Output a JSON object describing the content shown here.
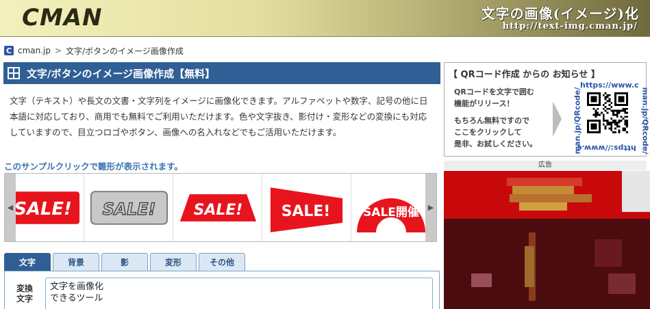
{
  "header": {
    "logo": "CMAN",
    "title": "文字の画像(イメージ)化",
    "url": "http://text-img.cman.jp/"
  },
  "breadcrumb": {
    "icon_letter": "C",
    "home": "cman.jp",
    "separator": ">",
    "current": "文字/ボタンのイメージ画像作成"
  },
  "main": {
    "title": "文字/ボタンのイメージ画像作成【無料】",
    "description": "文字（テキスト）や長文の文書・文字列をイメージに画像化できます。アルファベットや数字、記号の他に日本語に対応しており、商用でも無料でご利用いただけます。色や文字抜き、影付け・変形などの変換にも対応していますので、目立つロゴやボタン、画像への名入れなどでもご活用いただけます。",
    "sample_hint": "このサンプルクリックで雛形が表示されます。"
  },
  "samples": [
    {
      "label": "SALE!",
      "style": "red-box"
    },
    {
      "label": "SALE!",
      "style": "gray-button"
    },
    {
      "label": "SALE!",
      "style": "red-trapezoid"
    },
    {
      "label": "SALE!",
      "style": "red-flag"
    },
    {
      "label": "SALE開催",
      "style": "red-fan"
    }
  ],
  "colors": {
    "brand_blue": "#2f5f94",
    "sale_red": "#e8141d",
    "link_blue": "#3a72b3"
  },
  "tabs": [
    {
      "label": "文字",
      "active": true
    },
    {
      "label": "背景",
      "active": false
    },
    {
      "label": "影",
      "active": false
    },
    {
      "label": "変形",
      "active": false
    },
    {
      "label": "その他",
      "active": false
    }
  ],
  "form": {
    "label_line1": "変換",
    "label_line2": "文字",
    "text_value": "文字を画像化\nできるツール"
  },
  "news": {
    "title": "【 QRコード作成 からの お知らせ 】",
    "line1": "QRコードを文字で囲む",
    "line2": "機能がリリース！",
    "line3": "もちろん無料ですので",
    "line4": "ここをクリックして",
    "line5": "是非、お試しください。",
    "qr_top": "https://www.c",
    "qr_right": "man.jp/QRcode/",
    "qr_bottom": "https://www.c",
    "qr_left": "man.jp/QRcode/"
  },
  "ad": {
    "label": "広告"
  }
}
